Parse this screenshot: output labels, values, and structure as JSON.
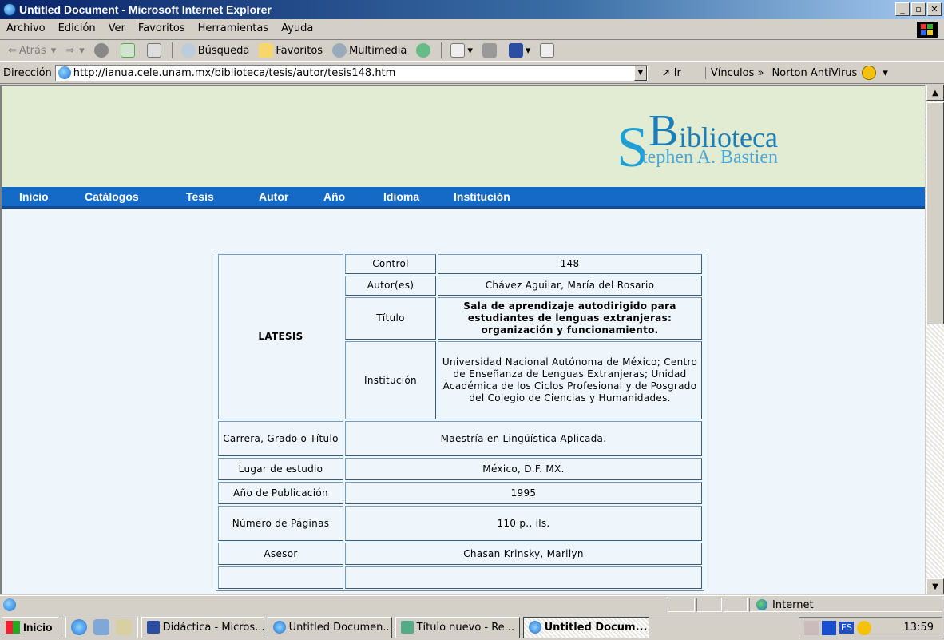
{
  "window": {
    "title": "Untitled Document - Microsoft Internet Explorer"
  },
  "menubar": {
    "items": [
      "Archivo",
      "Edición",
      "Ver",
      "Favoritos",
      "Herramientas",
      "Ayuda"
    ]
  },
  "toolbar": {
    "back": "Atrás",
    "search": "Búsqueda",
    "favorites": "Favoritos",
    "media": "Multimedia"
  },
  "address": {
    "label": "Dirección",
    "url": "http://ianua.cele.unam.mx/biblioteca/tesis/autor/tesis148.htm",
    "go": "Ir",
    "links": "Vínculos »",
    "norton": "Norton AntiVirus"
  },
  "logo": {
    "main": "Biblioteca",
    "sub": "Stephen A. Bastien"
  },
  "nav": {
    "items": [
      "Inicio",
      "Catálogos",
      "Tesis",
      "Autor",
      "Año",
      "Idioma",
      "Institución"
    ]
  },
  "record": {
    "heading": "LATESIS",
    "control_label": "Control",
    "control": "148",
    "author_label": "Autor(es)",
    "author": "Chávez Aguilar, María del Rosario",
    "title_label": "Título",
    "title": "Sala de aprendizaje autodirigido para estudiantes de lenguas extranjeras: organización y funcionamiento.",
    "institution_label": "Institución",
    "institution": "Universidad Nacional Autónoma de México; Centro de Enseñanza de Lenguas Extranjeras; Unidad Académica de los Ciclos Profesional y de Posgrado del Colegio de Ciencias y Humanidades.",
    "degree_label": "Carrera, Grado o Título",
    "degree": "Maestría en Lingüística Aplicada.",
    "place_label": "Lugar de estudio",
    "place": "México, D.F. MX.",
    "year_label": "Año de Publicación",
    "year": "1995",
    "pages_label": "Número de Páginas",
    "pages": "110 p., ils.",
    "advisor_label": "Asesor",
    "advisor": "Chasan Krinsky, Marilyn"
  },
  "status": {
    "zone": "Internet"
  },
  "taskbar": {
    "start": "Inicio",
    "tasks": [
      "Didáctica - Micros...",
      "Untitled Documen...",
      "Título nuevo - Re...",
      "Untitled Docum..."
    ],
    "lang": "ES",
    "clock": "13:59"
  }
}
